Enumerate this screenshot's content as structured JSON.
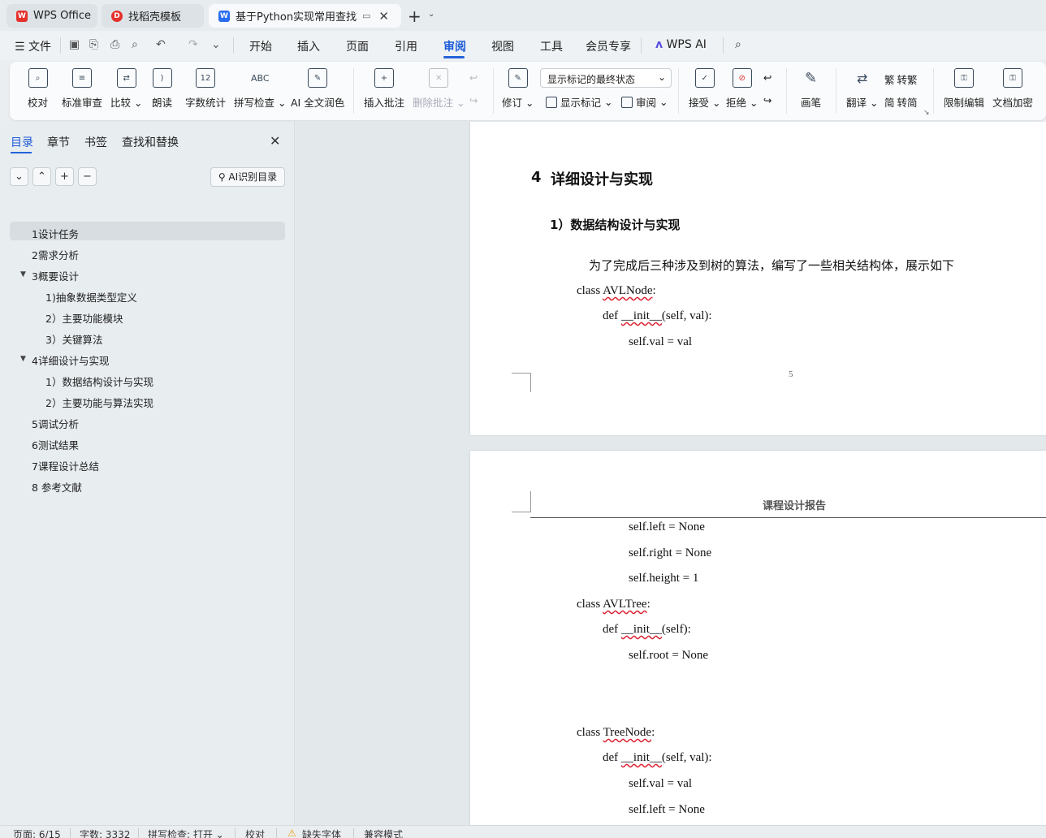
{
  "tabs": {
    "wps_office": "WPS Office",
    "template": "找稻壳模板",
    "document": "基于Python实现常用查找算法"
  },
  "menu": {
    "file": "文件",
    "items": [
      "开始",
      "插入",
      "页面",
      "引用",
      "审阅",
      "视图",
      "工具",
      "会员专享"
    ],
    "active": "审阅",
    "wps_ai": "WPS AI"
  },
  "ribbon": {
    "proofread": "校对",
    "standard_review": "标准审查",
    "compare": "比较",
    "read_aloud": "朗读",
    "word_count": "字数统计",
    "spell_check": "拼写检查",
    "ai_polish": "AI 全文润色",
    "insert_comment": "插入批注",
    "delete_comment": "删除批注",
    "track_changes": "修订",
    "markup_state": "显示标记的最终状态",
    "show_markup": "显示标记",
    "review": "审阅",
    "accept": "接受",
    "reject": "拒绝",
    "pen": "画笔",
    "translate": "翻译",
    "to_traditional": "转繁",
    "to_simplified": "转简",
    "restrict_editing": "限制编辑",
    "encrypt": "文档加密",
    "partial": "文"
  },
  "sidebar": {
    "tabs": [
      "目录",
      "章节",
      "书签",
      "查找和替换"
    ],
    "ai_toc": "AI识别目录",
    "toc": [
      "1设计任务",
      "2需求分析",
      "3概要设计",
      "1)抽象数据类型定义",
      "2）主要功能模块",
      "3）关键算法",
      "4详细设计与实现",
      "1）数据结构设计与实现",
      "2）主要功能与算法实现",
      "5调试分析",
      "6测试结果",
      "7课程设计总结",
      "8 参考文献"
    ]
  },
  "document": {
    "page1": {
      "heading_num": "4",
      "heading": "详细设计与实现",
      "subheading": "1）数据结构设计与实现",
      "paragraph": "为了完成后三种涉及到树的算法，编写了一些相关结构体，展示如下",
      "code1_kw": "class ",
      "code1_name": "AVLNode",
      "code1_colon": ":",
      "code2_kw": "def ",
      "code2_name": "__init__",
      "code2_rest": "(self, val):",
      "code3": "self.val = val",
      "page_number": "5"
    },
    "page2": {
      "header": "课程设计报告",
      "lines": [
        "self.left = None",
        "self.right = None",
        "self.height = 1"
      ],
      "avl_tree_kw": "class ",
      "avl_tree_name": "AVLTree",
      "colon": ":",
      "def_kw": "def ",
      "init_name": "__init__",
      "init_self": "(self):",
      "root_line": "self.root = None",
      "tree_node_name": "TreeNode",
      "init_self_val": "(self, val):",
      "val_line": "self.val = val",
      "left_line": "self.left = None"
    }
  },
  "status": {
    "page": "页面: 6/15",
    "words": "字数: 3332",
    "spell": "拼写检查: 打开",
    "proof": "校对",
    "missing_font": "缺失字体",
    "compat": "兼容模式"
  },
  "colors": {
    "accent": "#2563d9",
    "wps_red": "#e5312d",
    "doc_blue": "#2a6cf0"
  }
}
